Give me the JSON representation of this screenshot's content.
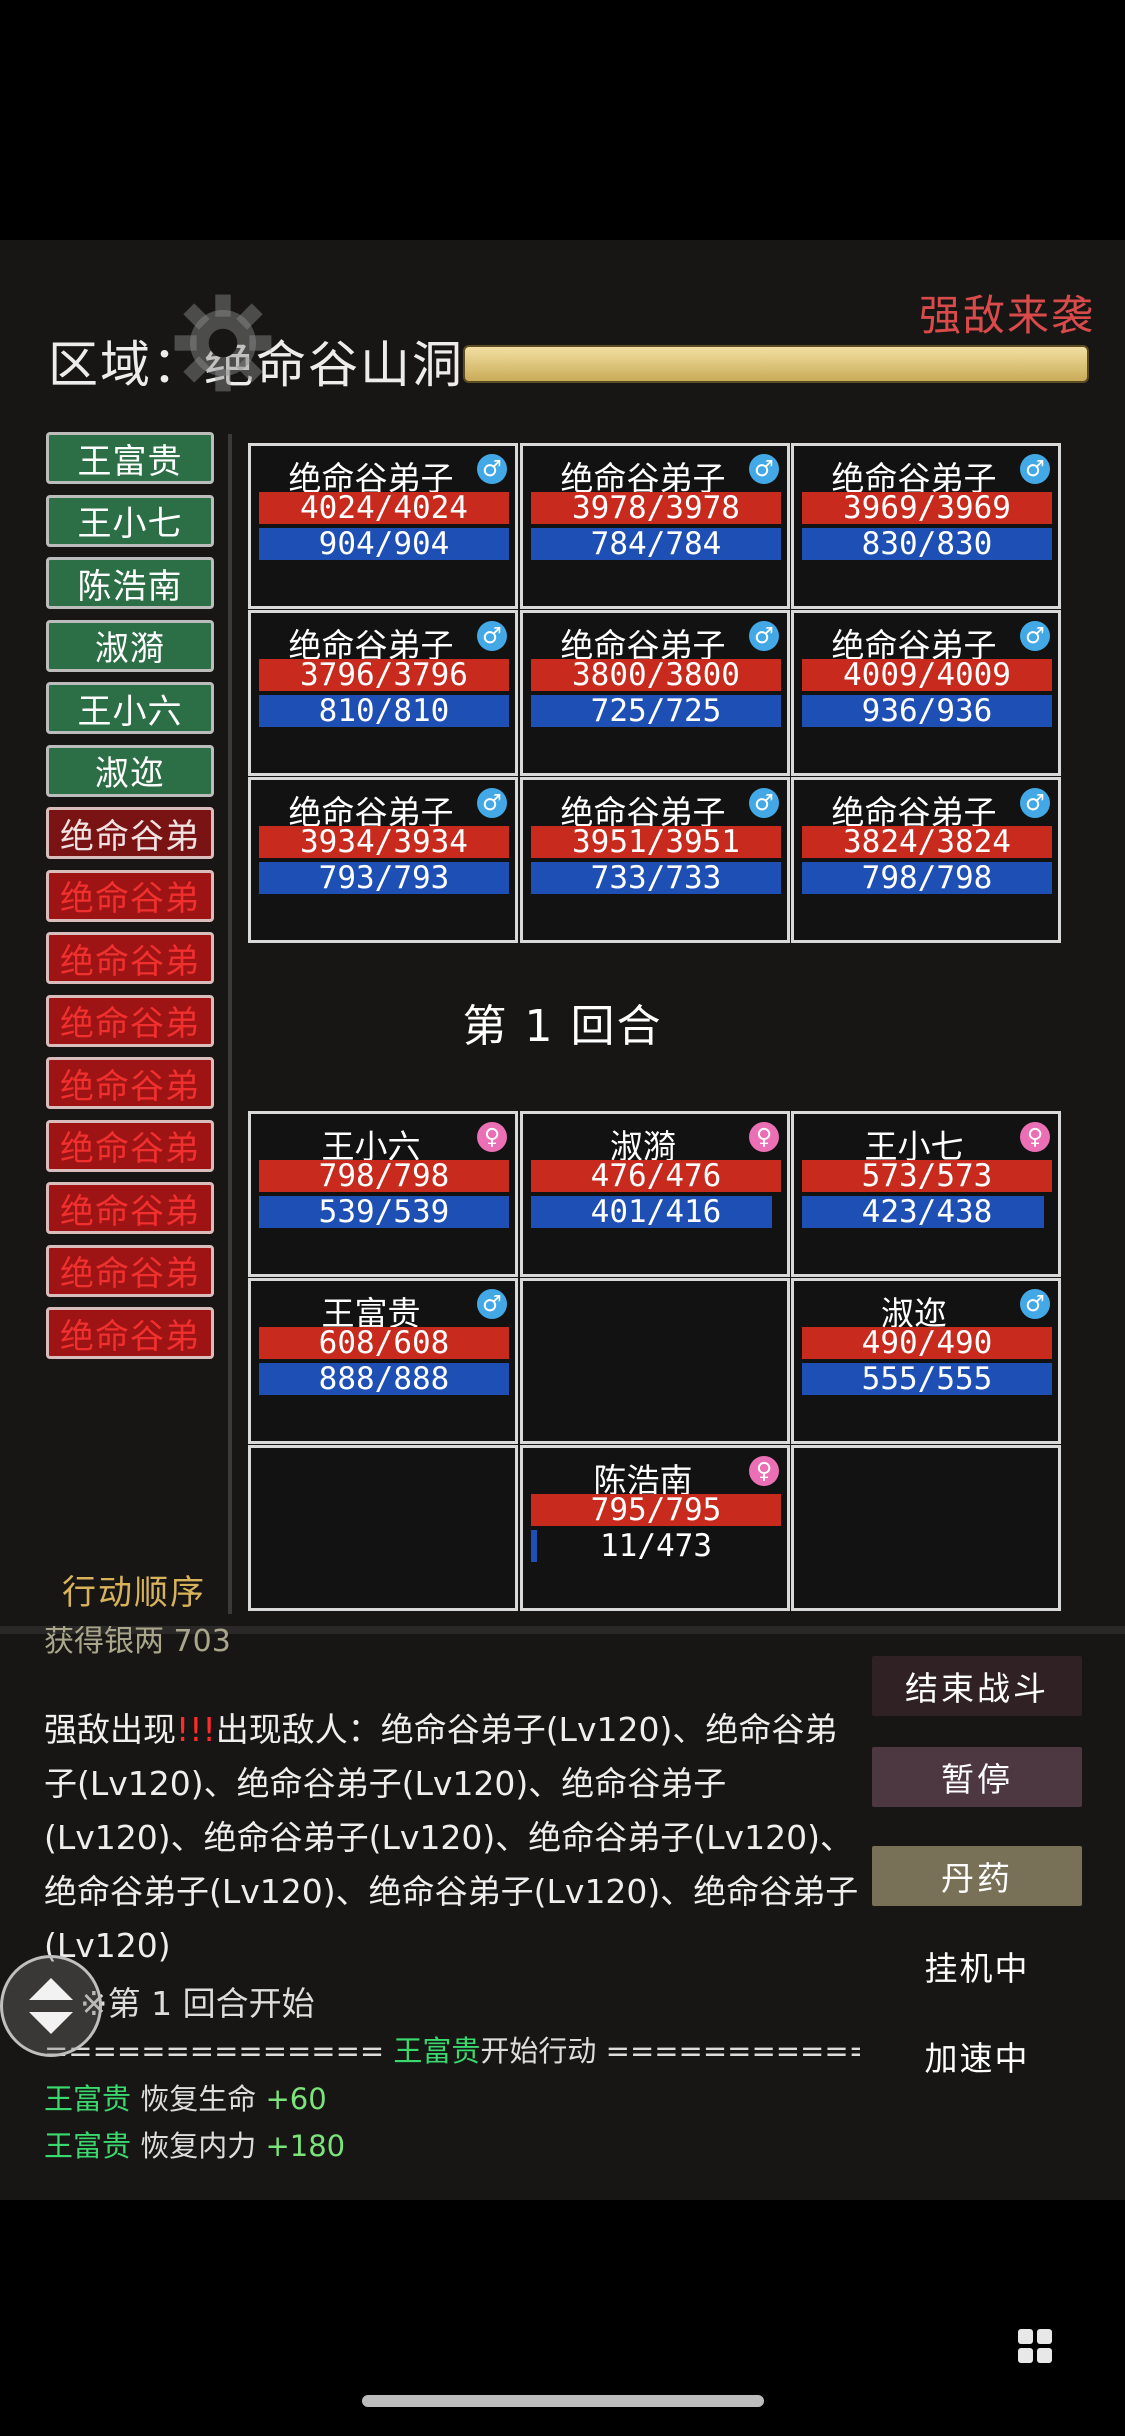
{
  "header": {
    "zone_label": "区域：",
    "zone_name": "绝命谷山洞",
    "alert": "强敌来袭",
    "zone_progress": 1.0
  },
  "action_order": {
    "label": "行动顺序",
    "allies": [
      "王富贵",
      "王小七",
      "陈浩南",
      "淑漪",
      "王小六",
      "淑迩"
    ],
    "enemies": [
      "绝命谷弟",
      "绝命谷弟",
      "绝命谷弟",
      "绝命谷弟",
      "绝命谷弟",
      "绝命谷弟",
      "绝命谷弟",
      "绝命谷弟",
      "绝命谷弟"
    ]
  },
  "enemies": [
    {
      "name": "绝命谷弟子",
      "sex": "♂",
      "hp": "4024/4024",
      "mp": "904/904"
    },
    {
      "name": "绝命谷弟子",
      "sex": "♂",
      "hp": "3978/3978",
      "mp": "784/784"
    },
    {
      "name": "绝命谷弟子",
      "sex": "♂",
      "hp": "3969/3969",
      "mp": "830/830"
    },
    {
      "name": "绝命谷弟子",
      "sex": "♂",
      "hp": "3796/3796",
      "mp": "810/810"
    },
    {
      "name": "绝命谷弟子",
      "sex": "♂",
      "hp": "3800/3800",
      "mp": "725/725"
    },
    {
      "name": "绝命谷弟子",
      "sex": "♂",
      "hp": "4009/4009",
      "mp": "936/936"
    },
    {
      "name": "绝命谷弟子",
      "sex": "♂",
      "hp": "3934/3934",
      "mp": "793/793"
    },
    {
      "name": "绝命谷弟子",
      "sex": "♂",
      "hp": "3951/3951",
      "mp": "733/733"
    },
    {
      "name": "绝命谷弟子",
      "sex": "♂",
      "hp": "3824/3824",
      "mp": "798/798"
    }
  ],
  "round_label": "第 1 回合",
  "allies": {
    "wang_xiaoliu": {
      "name": "王小六",
      "sex": "♀",
      "hp": "798/798",
      "mp": "539/539"
    },
    "shu_yi": {
      "name": "淑漪",
      "sex": "♀",
      "hp": "476/476",
      "mp": "401/416"
    },
    "wang_xiaoqi": {
      "name": "王小七",
      "sex": "♀",
      "hp": "573/573",
      "mp": "423/438"
    },
    "wang_fugui": {
      "name": "王富贵",
      "sex": "♂",
      "hp": "608/608",
      "mp": "888/888"
    },
    "shu_er": {
      "name": "淑迩",
      "sex": "♂",
      "hp": "490/490",
      "mp": "555/555"
    },
    "chen_haonan": {
      "name": "陈浩南",
      "sex": "♀",
      "hp": "795/795",
      "mp": "11/473"
    }
  },
  "ally_mp_fill": {
    "shu_yi": 0.964,
    "wang_xiaoqi": 0.966,
    "chen_haonan": 0.023
  },
  "log": {
    "cut_line": "获得银两 703",
    "enemy_appear_prefix": "强敌出现",
    "exclaim": "!!!",
    "enemy_appear_text": "出现敌人：绝命谷弟子(Lv120)、绝命谷弟子(Lv120)、绝命谷弟子(Lv120)、绝命谷弟子(Lv120)、绝命谷弟子(Lv120)、绝命谷弟子(Lv120)、绝命谷弟子(Lv120)、绝命谷弟子(Lv120)、绝命谷弟子(Lv120)",
    "round_start": "※第 1 回合开始",
    "sep_left": "==============",
    "actor": "王富贵",
    "action_start": "开始行动",
    "sep_right": "==============",
    "heal_hp_name": "王富贵",
    "heal_hp_text": "恢复生命",
    "heal_hp_val": "+60",
    "heal_mp_name": "王富贵",
    "heal_mp_text": "恢复内力",
    "heal_mp_val": "+180"
  },
  "controls": {
    "end_battle": "结束战斗",
    "pause": "暂停",
    "pill": "丹药",
    "idle_status": "挂机中",
    "speed_status": "加速中"
  }
}
